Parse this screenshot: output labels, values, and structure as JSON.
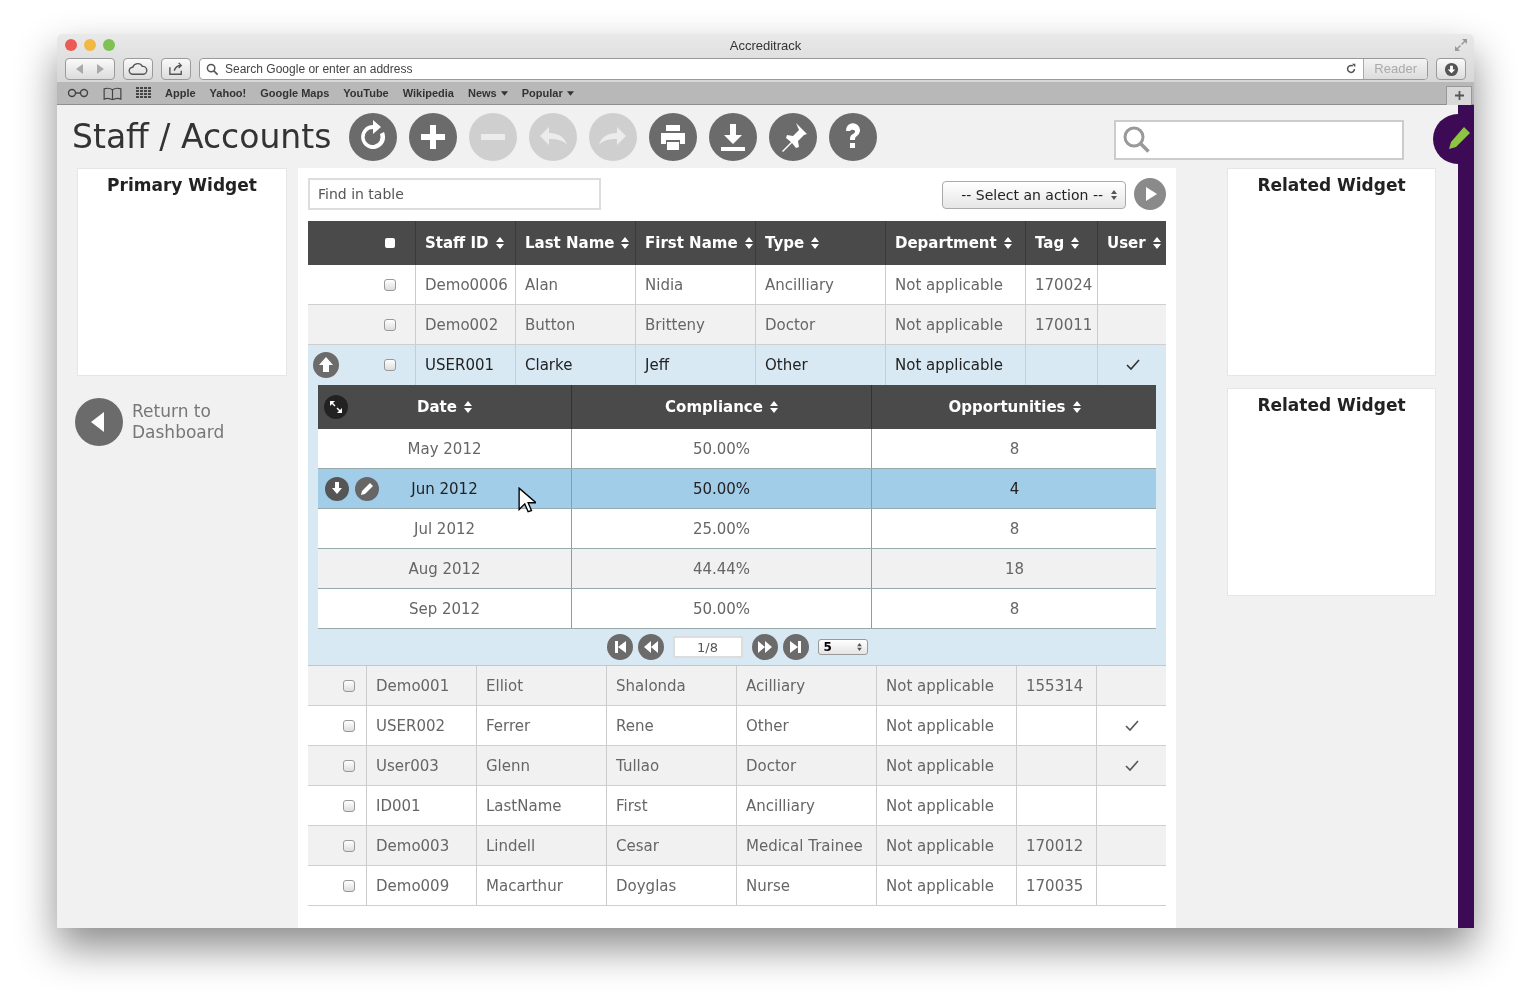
{
  "browser": {
    "title": "Accreditrack",
    "address_placeholder": "Search Google or enter an address",
    "reader": "Reader",
    "bookmarks": [
      {
        "label": "Apple",
        "menu": false
      },
      {
        "label": "Yahoo!",
        "menu": false
      },
      {
        "label": "Google Maps",
        "menu": false
      },
      {
        "label": "YouTube",
        "menu": false
      },
      {
        "label": "Wikipedia",
        "menu": false
      },
      {
        "label": "News",
        "menu": true
      },
      {
        "label": "Popular",
        "menu": true
      }
    ]
  },
  "page": {
    "title": "Staff / Accounts",
    "toolbar": [
      {
        "kind": "refresh",
        "disabled": false
      },
      {
        "kind": "add",
        "disabled": false
      },
      {
        "kind": "remove",
        "disabled": true
      },
      {
        "kind": "undo",
        "disabled": true
      },
      {
        "kind": "redo",
        "disabled": true
      },
      {
        "kind": "print",
        "disabled": false
      },
      {
        "kind": "download",
        "disabled": false
      },
      {
        "kind": "pin",
        "disabled": false
      },
      {
        "kind": "help",
        "disabled": false
      }
    ]
  },
  "primary_widget": {
    "title": "Primary Widget"
  },
  "return_link": "Return to Dashboard",
  "related_widgets": [
    {
      "title": "Related Widget"
    },
    {
      "title": "Related Widget"
    }
  ],
  "table": {
    "find_placeholder": "Find in table",
    "all_checked": false,
    "action_select": "-- Select an action --",
    "columns": [
      "Staff ID",
      "Last Name",
      "First Name",
      "Type",
      "Department",
      "Tag",
      "User"
    ],
    "rows": [
      {
        "cells": [
          "Demo0006",
          "Alan",
          "Nidia",
          "Ancilliary",
          "Not applicable",
          "170024"
        ],
        "user": false,
        "checked": false,
        "expanded": false
      },
      {
        "cells": [
          "Demo002",
          "Button",
          "Britteny",
          "Doctor",
          "Not applicable",
          "170011"
        ],
        "user": false,
        "checked": false,
        "expanded": false
      },
      {
        "cells": [
          "USER001",
          "Clarke",
          "Jeff",
          "Other",
          "Not applicable",
          ""
        ],
        "user": true,
        "checked": false,
        "expanded": true
      }
    ],
    "detail": {
      "columns": [
        "Date",
        "Compliance",
        "Opportunities"
      ],
      "rows": [
        {
          "cells": [
            "May 2012",
            "50.00%",
            "8"
          ],
          "selected": false
        },
        {
          "cells": [
            "Jun 2012",
            "50.00%",
            "4"
          ],
          "selected": true
        },
        {
          "cells": [
            "Jul 2012",
            "25.00%",
            "8"
          ],
          "selected": false
        },
        {
          "cells": [
            "Aug 2012",
            "44.44%",
            "18"
          ],
          "selected": false
        },
        {
          "cells": [
            "Sep 2012",
            "50.00%",
            "8"
          ],
          "selected": false
        }
      ],
      "page": "1/8",
      "page_size": "5"
    },
    "rows_after": [
      {
        "cells": [
          "Demo001",
          "Elliot",
          "Shalonda",
          "Acilliary",
          "Not applicable",
          "155314"
        ],
        "user": false,
        "checked": false
      },
      {
        "cells": [
          "USER002",
          "Ferrer",
          "Rene",
          "Other",
          "Not applicable",
          ""
        ],
        "user": true,
        "checked": false
      },
      {
        "cells": [
          "User003",
          "Glenn",
          "Tullao",
          "Doctor",
          "Not applicable",
          ""
        ],
        "user": true,
        "checked": false
      },
      {
        "cells": [
          "ID001",
          "LastName",
          "First",
          "Ancilliary",
          "Not applicable",
          ""
        ],
        "user": false,
        "checked": false
      },
      {
        "cells": [
          "Demo003",
          "Lindell",
          "Cesar",
          "Medical Trainee",
          "Not applicable",
          "170012"
        ],
        "user": false,
        "checked": false
      },
      {
        "cells": [
          "Demo009",
          "Macarthur",
          "Doyglas",
          "Nurse",
          "Not applicable",
          "170035"
        ],
        "user": false,
        "checked": false
      }
    ]
  }
}
